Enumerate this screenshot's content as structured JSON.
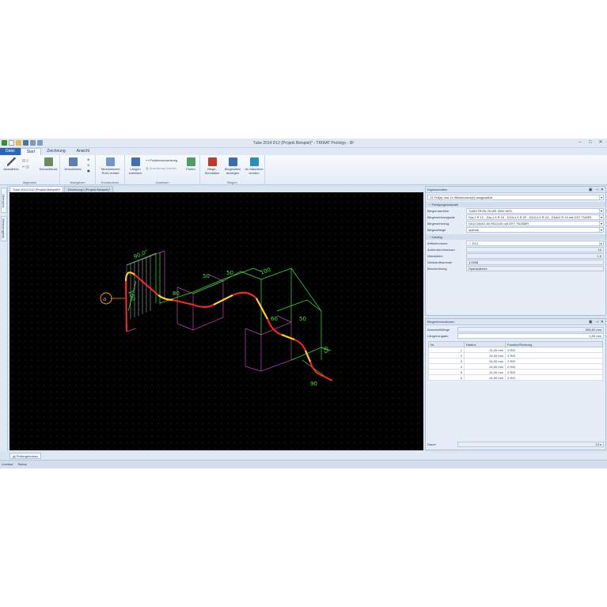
{
  "window": {
    "title": "Tube 2014 D12 (Projekt Beispiel)* - TRIRAT Prototyp - 3F"
  },
  "ribbon": {
    "tabs": [
      "Datei",
      "Start",
      "Zeichnung",
      "Ansicht"
    ],
    "groups": {
      "allgemein": {
        "label": "Allgemein",
        "buttons": [
          "Auswählen",
          "Schnelldruck"
        ]
      },
      "navigieren": {
        "label": "Navigieren",
        "buttons": [
          "Verschieben"
        ]
      },
      "konstruieren": {
        "label": "Konstruieren",
        "buttons": [
          "Tabellarischer Rohr-verlauf"
        ]
      },
      "zuweisen": {
        "label": "Zuweisen",
        "buttons": [
          "Längen zuweisen",
          "Positionszuweisung",
          "Zuweisung löschen",
          "Prüfen"
        ]
      },
      "biegen": {
        "label": "Biegen",
        "buttons": [
          "Biege-Simulation",
          "Biegedaten anzeigen",
          "An Maschine senden"
        ]
      }
    }
  },
  "left_strip": {
    "tabs": [
      "Übersicht",
      "Werkzeugliste"
    ]
  },
  "doc_tabs": [
    "Tube 2014 D12 (Projekt Beispiel)*",
    "Zeichnung1 (Projekt Beispiel)*"
  ],
  "drawing": {
    "label": "a",
    "dims": [
      "90,0°",
      "100",
      "80",
      "50",
      "50",
      "100",
      "60",
      "50",
      "95",
      "90"
    ]
  },
  "properties": {
    "title": "Eigenschaften",
    "selection": "13 Teil(e) und 11 Hilfselement(e) ausgewählt",
    "section_fertigung": "Fertigungsauswahl",
    "rows": [
      {
        "label": "Biegemaschine",
        "value": "TUBOTRON 25 MR 3000 MITL"
      },
      {
        "label": "Biegewerkzeugsatz",
        "value": "Dia-1 R.12 - Dia-1,5 R.16 - D10x1,5 R.20 - D12x1,5 R.24 - D16x2 R.24 mit GST TN25R"
      },
      {
        "label": "Biegewerkzeug",
        "value": "D012,00x01,50 R024,00 mit GST TN25MR"
      },
      {
        "label": "Biegeabfolge",
        "value": "optimal"
      }
    ],
    "section_katalog": "Katalog",
    "katalog": [
      {
        "label": "Artikelnummer",
        "value": "D14"
      },
      {
        "label": "Außendurchmesser",
        "value": "12"
      },
      {
        "label": "Wanddicke",
        "value": "1,5"
      },
      {
        "label": "Werkstoffnummer",
        "value": "1.0308"
      },
      {
        "label": "Beschreibung",
        "value": "Hydraulikrohr"
      }
    ]
  },
  "bending": {
    "title": "Biegeinformationen",
    "rows": [
      {
        "label": "Ausschnittlänge",
        "value": "590,81 mm"
      },
      {
        "label": "Längenzugabe",
        "value": "0,00 mm"
      }
    ],
    "columns": [
      "Nr.",
      "Radius",
      "Position/Richtung"
    ],
    "table": [
      {
        "nr": "1",
        "radius": "24,00 mm",
        "pos": "2 R/D"
      },
      {
        "nr": "2",
        "radius": "24,00 mm",
        "pos": "2 R/D"
      },
      {
        "nr": "3",
        "radius": "24,00 mm",
        "pos": "2 R/D"
      },
      {
        "nr": "4",
        "radius": "24,00 mm",
        "pos": "2 R/D"
      },
      {
        "nr": "5",
        "radius": "24,00 mm",
        "pos": "2 R/D"
      },
      {
        "nr": "6",
        "radius": "24,00 mm",
        "pos": "2 R/D"
      }
    ],
    "duration_label": "Dauer",
    "duration_value": "13 s"
  },
  "bottom": {
    "tab": "Prüfergebnisse",
    "status": [
      "Leerlauf",
      "Status"
    ]
  }
}
